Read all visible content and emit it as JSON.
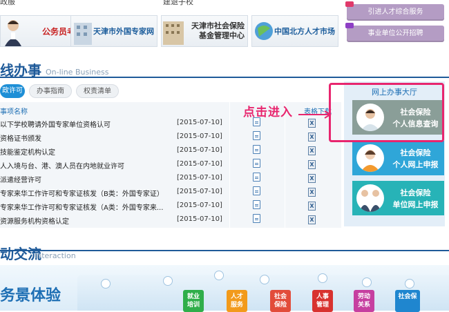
{
  "top": {
    "left_text": "政服",
    "mid_text": "建退子校"
  },
  "banners": [
    {
      "text_line1": "公务员考录",
      "text_line2": ""
    },
    {
      "text_line1": "天津市外国专家网",
      "text_line2": ""
    },
    {
      "text_line1": "天津市社会保险",
      "text_line2": "基金管理中心"
    },
    {
      "text_line1": "中国北方人才市场",
      "text_line2": ""
    }
  ],
  "side_buttons": [
    "引进人才综合服务",
    "事业单位公开招聘"
  ],
  "online_section": {
    "title": "线办事",
    "subtitle": "On-line Business",
    "tabs": [
      "政许可",
      "办事指南",
      "权责清单"
    ],
    "col_name": "事项名称",
    "col_download": "表格下载",
    "rows": [
      {
        "name": "以下学校聘请外国专家单位资格认可",
        "date": "[2015-07-10]"
      },
      {
        "name": "资格证书颁发",
        "date": "[2015-07-10]"
      },
      {
        "name": "技能鉴定机构认定",
        "date": "[2015-07-10]"
      },
      {
        "name": "人入境与台、港、澳人员在内地就业许可",
        "date": "[2015-07-10]"
      },
      {
        "name": "派遣经营许可",
        "date": "[2015-07-10]"
      },
      {
        "name": "专家来华工作许可和专家证核发（B类：外国专家证）",
        "date": "[2015-07-10]"
      },
      {
        "name": "专家来华工作许可和专家证核发（A类：外国专家来...",
        "date": "[2015-07-10]"
      },
      {
        "name": "资源服务机构资格认定",
        "date": "[2015-07-10]"
      }
    ]
  },
  "right_panel": {
    "title": "网上办事大厅",
    "services": [
      {
        "line1": "社会保险",
        "line2": "个人信息查询",
        "color": "#8a9e98"
      },
      {
        "line1": "社会保险",
        "line2": "个人网上申报",
        "color": "#2fa6d8"
      },
      {
        "line1": "社会保险",
        "line2": "单位网上申报",
        "color": "#27b3b7"
      }
    ]
  },
  "annotation": "点击进入",
  "interaction_section": {
    "title": "动交流",
    "subtitle": "Interaction",
    "banner_text": "务景体验",
    "tiles": [
      {
        "label": "就业\n培训",
        "color": "#2fae4a"
      },
      {
        "label": "人才\n服务",
        "color": "#f29a1b"
      },
      {
        "label": "社会\n保险",
        "color": "#e24c3a"
      },
      {
        "label": "人事\n管理",
        "color": "#d8322f"
      },
      {
        "label": "劳动\n关系",
        "color": "#c63fa0"
      },
      {
        "label": "社会保",
        "color": "#1f86cf"
      }
    ]
  }
}
